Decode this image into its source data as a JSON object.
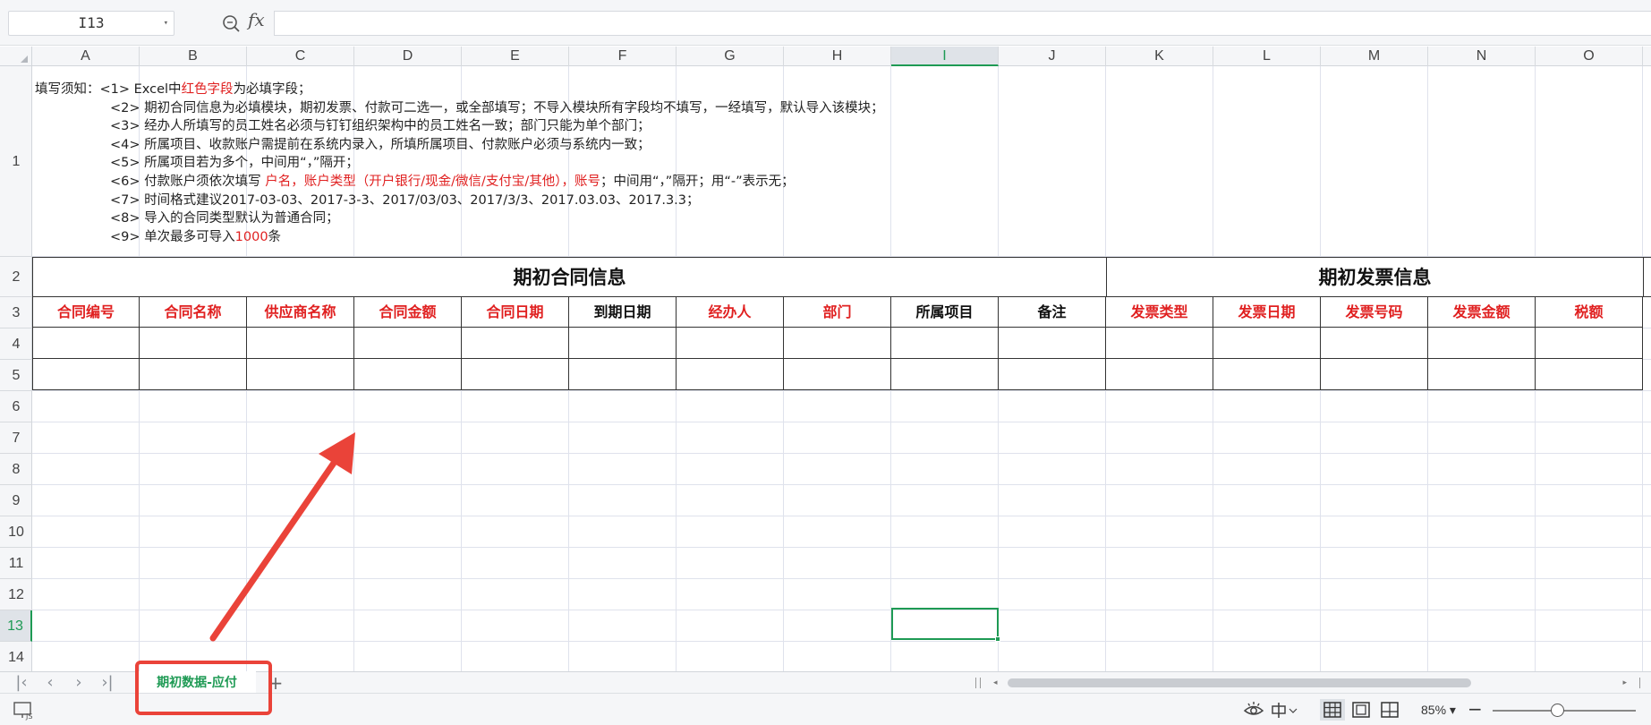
{
  "formula_bar": {
    "name_box": "I13",
    "fx_label": "fx",
    "formula_value": ""
  },
  "columns": [
    "A",
    "B",
    "C",
    "D",
    "E",
    "F",
    "G",
    "H",
    "I",
    "J",
    "K",
    "L",
    "M",
    "N",
    "O"
  ],
  "active_column": "I",
  "rows": [
    "1",
    "2",
    "3",
    "4",
    "5",
    "6",
    "7",
    "8",
    "9",
    "10",
    "11",
    "12",
    "13",
    "14"
  ],
  "active_row": "13",
  "instructions": {
    "lead": "填写须知：",
    "lines": [
      {
        "num": "<1> ",
        "parts": [
          {
            "t": "Excel中",
            "red": false
          },
          {
            "t": "红色字段",
            "red": true
          },
          {
            "t": "为必填字段；",
            "red": false
          }
        ]
      },
      {
        "num": "<2> ",
        "parts": [
          {
            "t": "期初合同信息为必填模块，期初发票、付款可二选一，或全部填写；不导入模块所有字段均不填写，一经填写，默认导入该模块；",
            "red": false
          }
        ]
      },
      {
        "num": "<3> ",
        "parts": [
          {
            "t": "经办人所填写的员工姓名必须与钉钉组织架构中的员工姓名一致；部门只能为单个部门；",
            "red": false
          }
        ]
      },
      {
        "num": "<4> ",
        "parts": [
          {
            "t": "所属项目、收款账户需提前在系统内录入，所填所属项目、付款账户必须与系统内一致；",
            "red": false
          }
        ]
      },
      {
        "num": "<5> ",
        "parts": [
          {
            "t": "所属项目若为多个，中间用“，”隔开；",
            "red": false
          }
        ]
      },
      {
        "num": "<6> ",
        "parts": [
          {
            "t": "付款账户须依次填写 ",
            "red": false
          },
          {
            "t": "户名，账户类型（开户银行/现金/微信/支付宝/其他），账号",
            "red": true
          },
          {
            "t": "；中间用“，”隔开；用“-”表示无；",
            "red": false
          }
        ]
      },
      {
        "num": "<7> ",
        "parts": [
          {
            "t": "时间格式建议2017-03-03、2017-3-3、2017/03/03、2017/3/3、2017.03.03、2017.3.3；",
            "red": false
          }
        ]
      },
      {
        "num": "<8> ",
        "parts": [
          {
            "t": "导入的合同类型默认为普通合同；",
            "red": false
          }
        ]
      },
      {
        "num": "<9> ",
        "parts": [
          {
            "t": "单次最多可导入",
            "red": false
          },
          {
            "t": "1000",
            "red": true
          },
          {
            "t": "条",
            "red": false
          }
        ]
      }
    ]
  },
  "sections": {
    "contract": "期初合同信息",
    "invoice": "期初发票信息"
  },
  "field_headers": [
    {
      "label": "合同编号",
      "required": true
    },
    {
      "label": "合同名称",
      "required": true
    },
    {
      "label": "供应商名称",
      "required": true
    },
    {
      "label": "合同金额",
      "required": true
    },
    {
      "label": "合同日期",
      "required": true
    },
    {
      "label": "到期日期",
      "required": false
    },
    {
      "label": "经办人",
      "required": true
    },
    {
      "label": "部门",
      "required": true
    },
    {
      "label": "所属项目",
      "required": false
    },
    {
      "label": "备注",
      "required": false
    },
    {
      "label": "发票类型",
      "required": true
    },
    {
      "label": "发票日期",
      "required": true
    },
    {
      "label": "发票号码",
      "required": true
    },
    {
      "label": "发票金额",
      "required": true
    },
    {
      "label": "税额",
      "required": true
    }
  ],
  "sheet_tabs": [
    {
      "label": "期初数据-应付",
      "active": true
    }
  ],
  "add_sheet_label": "+",
  "status_bar": {
    "zoom": "85%",
    "zoom_fraction": 0.45
  },
  "colors": {
    "accent": "#1e9a54",
    "required_text": "#e02020",
    "annotation": "#ea4339"
  },
  "icons": {
    "zoom_search": "magnifier-icon",
    "eye": "eye-protection-icon",
    "input_method": "chinese-input-icon",
    "normal_view": "normal-view-icon",
    "page_layout": "page-layout-icon",
    "page_break": "page-break-icon"
  }
}
